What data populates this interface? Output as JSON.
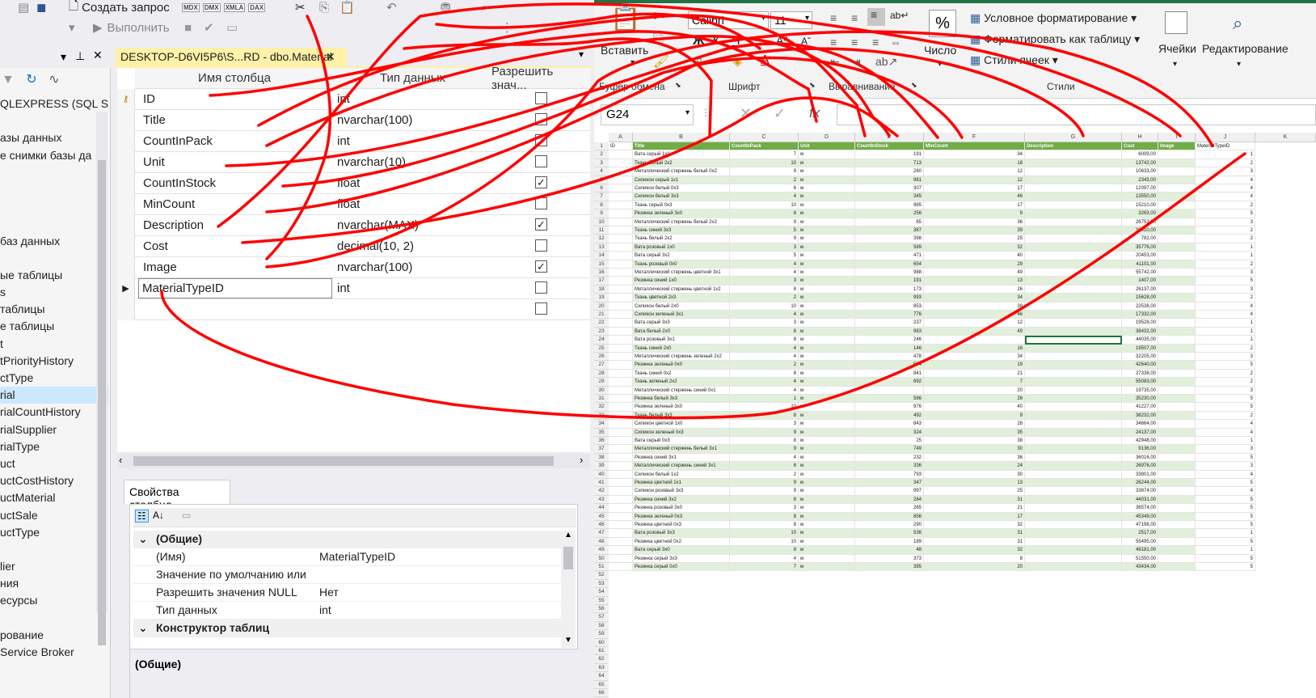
{
  "ssms": {
    "toolbar": {
      "new_query": "Создать запрос",
      "execute": "Выполнить",
      "mini_icons": [
        "MDX",
        "DMX",
        "XMLA",
        "DAX"
      ]
    },
    "tab_title": "DESKTOP-D6VI5P6\\S...RD - dbo.Material",
    "object_explorer": {
      "items": [
        "QLEXPRESS (SQL S",
        "",
        "азы данных",
        "е снимки базы да",
        "",
        "",
        "",
        "",
        "баз данных",
        "",
        "ые таблицы",
        "s",
        "таблицы",
        "е таблицы",
        "t",
        "tPriorityHistory",
        "ctType",
        "rial",
        "rialCountHistory",
        "rialSupplier",
        "rialType",
        "uct",
        "uctCostHistory",
        "uctMaterial",
        "uctSale",
        "uctType",
        "",
        "lier",
        "ния",
        "есурсы",
        "",
        "рование",
        "Service Broker"
      ],
      "selected_index": 17
    },
    "designer": {
      "headers": [
        "Имя столбца",
        "Тип данных",
        "Разрешить знач..."
      ],
      "rows": [
        {
          "name": "ID",
          "type": "int",
          "null": false,
          "key": true
        },
        {
          "name": "Title",
          "type": "nvarchar(100)",
          "null": false
        },
        {
          "name": "CountInPack",
          "type": "int",
          "null": false
        },
        {
          "name": "Unit",
          "type": "nvarchar(10)",
          "null": false
        },
        {
          "name": "CountInStock",
          "type": "float",
          "null": true
        },
        {
          "name": "MinCount",
          "type": "float",
          "null": false
        },
        {
          "name": "Description",
          "type": "nvarchar(MAX)",
          "null": true
        },
        {
          "name": "Cost",
          "type": "decimal(10, 2)",
          "null": false
        },
        {
          "name": "Image",
          "type": "nvarchar(100)",
          "null": true
        },
        {
          "name": "MaterialTypeID",
          "type": "int",
          "null": false,
          "current": true
        },
        {
          "name": "",
          "type": "",
          "null": false
        }
      ]
    },
    "properties": {
      "tab": "Свойства столбца",
      "rows": [
        {
          "cat": true,
          "label": "(Общие)",
          "value": ""
        },
        {
          "label": "(Имя)",
          "value": "MaterialTypeID"
        },
        {
          "label": "Значение по умолчанию или",
          "value": ""
        },
        {
          "label": "Разрешить значения NULL",
          "value": "Нет"
        },
        {
          "label": "Тип данных",
          "value": "int"
        },
        {
          "cat": true,
          "label": "Конструктор таблиц",
          "value": ""
        }
      ],
      "footer": "(Общие)"
    }
  },
  "excel": {
    "font_name": "Calibri",
    "font_size": "11",
    "paste": "Вставить",
    "clipboard": "Буфер обмена",
    "font_group": "Шрифт",
    "align_group": "Выравнивание",
    "number": "Число",
    "cond_format": "Условное форматирование",
    "format_table": "Форматировать как таблицу",
    "cell_styles": "Стили ячеек",
    "styles_group": "Стили",
    "cells": "Ячейки",
    "editing": "Редактирование",
    "name_box": "G24",
    "fx": "fx",
    "col_letters": [
      "A",
      "B",
      "C",
      "D",
      "E",
      "F",
      "G",
      "H",
      "I",
      "J",
      "K"
    ],
    "headers": [
      "ID",
      "Title",
      "CountInPack",
      "Unit",
      "CountInStock",
      "MinCount",
      "Description",
      "Cost",
      "Image",
      "MaterialTypeID"
    ],
    "rows": [
      [
        "Вата серый 1х1",
        "7",
        "м",
        "191",
        "34",
        "6009,00",
        "1"
      ],
      [
        "Ткань белый 2х2",
        "10",
        "м",
        "713",
        "18",
        "13742,00",
        "2"
      ],
      [
        "Металлический стержень белый 0х2",
        "9",
        "м",
        "280",
        "12",
        "10633,00",
        "3"
      ],
      [
        "Силикон серый 1х1",
        "2",
        "м",
        "981",
        "12",
        "2343,00",
        "4"
      ],
      [
        "Силикон белый 0х3",
        "6",
        "м",
        "307",
        "17",
        "12097,00",
        "4"
      ],
      [
        "Силикон белый 3х3",
        "4",
        "м",
        "345",
        "46",
        "13550,00",
        "4"
      ],
      [
        "Ткань серый 0х3",
        "10",
        "м",
        "965",
        "17",
        "15210,00",
        "2"
      ],
      [
        "Резинка зеленый 3х0",
        "8",
        "м",
        "256",
        "9",
        "3263,00",
        "5"
      ],
      [
        "Металлический стержень белый 2х2",
        "9",
        "м",
        "65",
        "36",
        "26753,00",
        "3"
      ],
      [
        "Ткань синий 3х3",
        "5",
        "м",
        "387",
        "39",
        "32910,00",
        "2"
      ],
      [
        "Ткань белый 2х2",
        "9",
        "м",
        "398",
        "25",
        "782,00",
        "2"
      ],
      [
        "Вата розовый 1х0",
        "3",
        "м",
        "589",
        "32",
        "35776,00",
        "1"
      ],
      [
        "Вата серый 3х2",
        "5",
        "м",
        "471",
        "40",
        "20453,00",
        "1"
      ],
      [
        "Ткань розовый 0х0",
        "4",
        "м",
        "654",
        "29",
        "41101,00",
        "2"
      ],
      [
        "Металлический стержень цветной 3х1",
        "4",
        "м",
        "988",
        "49",
        "55742,00",
        "3"
      ],
      [
        "Резинка синий 1х0",
        "3",
        "м",
        "191",
        "13",
        "1407,00",
        "5"
      ],
      [
        "Металлический стержень цветной 1х2",
        "8",
        "м",
        "173",
        "26",
        "26137,00",
        "3"
      ],
      [
        "Ткань цветной 2х3",
        "2",
        "м",
        "993",
        "34",
        "15628,00",
        "2"
      ],
      [
        "Силикон белый 2х0",
        "10",
        "м",
        "853",
        "38",
        "22538,00",
        "4"
      ],
      [
        "Силикон зеленый 3х1",
        "4",
        "м",
        "776",
        "46",
        "17332,00",
        "4"
      ],
      [
        "Вата серый 3х3",
        "3",
        "м",
        "237",
        "12",
        "19528,00",
        "1"
      ],
      [
        "Вата белый 2х0",
        "8",
        "м",
        "983",
        "49",
        "38432,00",
        "1"
      ],
      [
        "Вата розовый 3х1",
        "8",
        "м",
        "246",
        "",
        "44035,00",
        "1"
      ],
      [
        "Ткань синий 2х0",
        "4",
        "м",
        "146",
        "16",
        "19507,00",
        "2"
      ],
      [
        "Металлический стержень зеленый 2х2",
        "4",
        "м",
        "478",
        "34",
        "32205,00",
        "3"
      ],
      [
        "Резинка зеленый 0х0",
        "2",
        "м",
        "594",
        "19",
        "42640,00",
        "5"
      ],
      [
        "Ткань синий 0х2",
        "8",
        "м",
        "841",
        "21",
        "27338,00",
        "2"
      ],
      [
        "Ткань зеленый 2х2",
        "4",
        "м",
        "692",
        "7",
        "55083,00",
        "2"
      ],
      [
        "Металлический стержень синий 0х1",
        "4",
        "м",
        "",
        "20",
        "19735,00",
        "3"
      ],
      [
        "Резинка белый 3х3",
        "1",
        "м",
        "586",
        "26",
        "35230,00",
        "5"
      ],
      [
        "Резинка зеленый 3х0",
        "10",
        "м",
        "976",
        "40",
        "41227,00",
        "5"
      ],
      [
        "Ткань белый 3х3",
        "8",
        "м",
        "492",
        "9",
        "38232,00",
        "2"
      ],
      [
        "Силикон цветной 1х0",
        "3",
        "м",
        "843",
        "28",
        "34664,00",
        "4"
      ],
      [
        "Силикон зеленый 0х3",
        "9",
        "м",
        "324",
        "35",
        "24137,00",
        "4"
      ],
      [
        "Вата серый 0х3",
        "8",
        "м",
        "25",
        "38",
        "42948,00",
        "1"
      ],
      [
        "Металлический стержень белый 3х1",
        "9",
        "м",
        "749",
        "30",
        "9136,00",
        "3"
      ],
      [
        "Резинка синий 3х1",
        "4",
        "м",
        "232",
        "36",
        "36016,00",
        "5"
      ],
      [
        "Металлический стержень синий 3х1",
        "6",
        "м",
        "336",
        "24",
        "26976,00",
        "3"
      ],
      [
        "Силикон белый 1х2",
        "2",
        "м",
        "793",
        "30",
        "33801,00",
        "4"
      ],
      [
        "Резинка цветной 1х1",
        "9",
        "м",
        "347",
        "13",
        "26244,00",
        "5"
      ],
      [
        "Силикон розовый 3х3",
        "9",
        "м",
        "997",
        "25",
        "33874,00",
        "4"
      ],
      [
        "Резинка синий 3х2",
        "8",
        "м",
        "284",
        "31",
        "44031,00",
        "5"
      ],
      [
        "Резинка розовый 3х0",
        "3",
        "м",
        "265",
        "21",
        "36574,00",
        "5"
      ],
      [
        "Резинка зеленый 0х3",
        "8",
        "м",
        "856",
        "17",
        "45349,00",
        "5"
      ],
      [
        "Резинка цветной 0х3",
        "8",
        "м",
        "290",
        "32",
        "47198,00",
        "5"
      ],
      [
        "Вата розовый 3х3",
        "10",
        "м",
        "536",
        "31",
        "2517,00",
        "1"
      ],
      [
        "Резинка цветной 0х2",
        "10",
        "м",
        "189",
        "31",
        "55495,00",
        "5"
      ],
      [
        "Вата серый 3х0",
        "8",
        "м",
        "48",
        "32",
        "49181,00",
        "1"
      ],
      [
        "Резинка серый 3х3",
        "4",
        "м",
        "373",
        "8",
        "51550,00",
        "5"
      ],
      [
        "Резинка серый 0х0",
        "7",
        "м",
        "395",
        "20",
        "43434,00",
        "5"
      ]
    ],
    "empty_rows": [
      "52",
      "53",
      "54",
      "55",
      "56",
      "57",
      "58",
      "59",
      "60",
      "61",
      "62",
      "63",
      "64",
      "65",
      "66",
      "67",
      "68",
      "69"
    ]
  }
}
